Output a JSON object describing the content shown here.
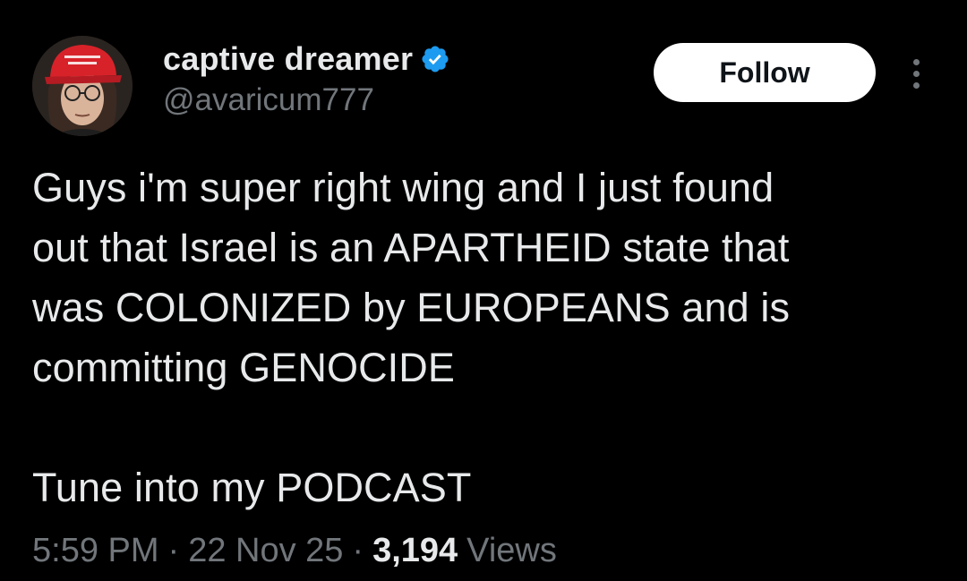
{
  "author": {
    "display_name": "captive dreamer",
    "handle": "@avaricum777",
    "verified": true,
    "verified_color": "#1d9bf0",
    "avatar_icon": "profile-photo-red-cap"
  },
  "actions": {
    "follow_label": "Follow",
    "more_icon": "more-vertical-icon"
  },
  "tweet": {
    "lines": [
      "Guys i'm super right wing and I just found",
      "out that Israel is an APARTHEID state that",
      "was COLONIZED by EUROPEANS and is",
      "committing GENOCIDE"
    ],
    "lines_2": [
      "Tune into my PODCAST"
    ]
  },
  "meta": {
    "time": "5:59 PM",
    "separator": "·",
    "date": "22 Nov 25",
    "views_count": "3,194",
    "views_label": "Views"
  },
  "colors": {
    "background": "#000000",
    "text_primary": "#e7e9ea",
    "text_secondary": "#71767b",
    "follow_bg": "#ffffff"
  }
}
